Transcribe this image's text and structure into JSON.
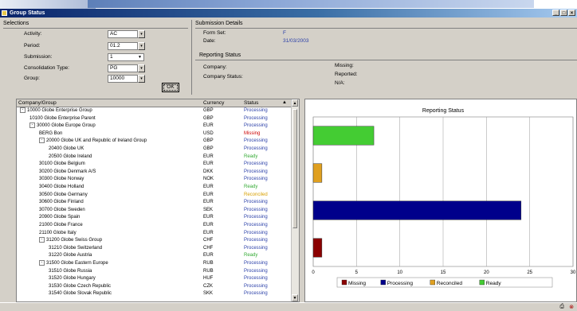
{
  "window": {
    "title": "Group Status",
    "buttons": [
      "_",
      "□",
      "×"
    ]
  },
  "selections": {
    "heading": "Selections",
    "fields": [
      {
        "label": "Activity:",
        "value": "AC"
      },
      {
        "label": "Period:",
        "value": "01.2"
      },
      {
        "label": "Submission:",
        "value": "1"
      },
      {
        "label": "Consolidation Type:",
        "value": "PG"
      },
      {
        "label": "Group:",
        "value": "10000"
      }
    ],
    "ok_label": "OK"
  },
  "submission_details": {
    "heading": "Submission Details",
    "rows": [
      {
        "label": "Form Set:",
        "value": "F"
      },
      {
        "label": "Date:",
        "value": "31/03/2003"
      }
    ]
  },
  "reporting_status_panel": {
    "heading": "Reporting Status",
    "left": [
      {
        "label": "Company:"
      },
      {
        "label": "Company Status:"
      }
    ],
    "right": [
      {
        "label": "Missing:"
      },
      {
        "label": "Reported:"
      },
      {
        "label": "N/A:"
      }
    ]
  },
  "tree": {
    "columns": [
      "Company/Group",
      "Currency",
      "Status"
    ],
    "rows": [
      {
        "name": "10000 Globe Enterprise Group",
        "indent": 0,
        "exp": "-",
        "currency": "GBP",
        "status": "Processing"
      },
      {
        "name": "10100 Globe Enterprise Parent",
        "indent": 1,
        "exp": "",
        "currency": "GBP",
        "status": "Processing"
      },
      {
        "name": "30000 Globe Europe Group",
        "indent": 1,
        "exp": "-",
        "currency": "EUR",
        "status": "Processing"
      },
      {
        "name": "BERG Bon",
        "indent": 2,
        "exp": "",
        "currency": "USD",
        "status": "Missing"
      },
      {
        "name": "20000 Globe UK and Republic of Ireland Group",
        "indent": 2,
        "exp": "-",
        "currency": "GBP",
        "status": "Processing"
      },
      {
        "name": "20400 Globe UK",
        "indent": 3,
        "exp": "",
        "currency": "GBP",
        "status": "Processing"
      },
      {
        "name": "20500 Globe Ireland",
        "indent": 3,
        "exp": "",
        "currency": "EUR",
        "status": "Ready"
      },
      {
        "name": "30100 Globe Belgium",
        "indent": 2,
        "exp": "",
        "currency": "EUR",
        "status": "Processing"
      },
      {
        "name": "30200 Globe Denmark A/S",
        "indent": 2,
        "exp": "",
        "currency": "DKK",
        "status": "Processing"
      },
      {
        "name": "30300 Globe Norway",
        "indent": 2,
        "exp": "",
        "currency": "NOK",
        "status": "Processing"
      },
      {
        "name": "30400 Globe Holland",
        "indent": 2,
        "exp": "",
        "currency": "EUR",
        "status": "Ready"
      },
      {
        "name": "30500 Globe Germany",
        "indent": 2,
        "exp": "",
        "currency": "EUR",
        "status": "Reconciled"
      },
      {
        "name": "30600 Globe Finland",
        "indent": 2,
        "exp": "",
        "currency": "EUR",
        "status": "Processing"
      },
      {
        "name": "30700 Globe Sweden",
        "indent": 2,
        "exp": "",
        "currency": "SEK",
        "status": "Processing"
      },
      {
        "name": "20900 Globe Spain",
        "indent": 2,
        "exp": "",
        "currency": "EUR",
        "status": "Processing"
      },
      {
        "name": "21000 Globe France",
        "indent": 2,
        "exp": "",
        "currency": "EUR",
        "status": "Processing"
      },
      {
        "name": "21100 Globe Italy",
        "indent": 2,
        "exp": "",
        "currency": "EUR",
        "status": "Processing"
      },
      {
        "name": "31200 Globe Swiss Group",
        "indent": 2,
        "exp": "-",
        "currency": "CHF",
        "status": "Processing"
      },
      {
        "name": "31210 Globe Switzerland",
        "indent": 3,
        "exp": "",
        "currency": "CHF",
        "status": "Processing"
      },
      {
        "name": "31220 Globe Austria",
        "indent": 3,
        "exp": "",
        "currency": "EUR",
        "status": "Ready"
      },
      {
        "name": "31500 Globe Eastern Europe",
        "indent": 2,
        "exp": "-",
        "currency": "RUB",
        "status": "Processing"
      },
      {
        "name": "31510 Globe Russia",
        "indent": 3,
        "exp": "",
        "currency": "RUB",
        "status": "Processing"
      },
      {
        "name": "31520 Globe Hungary",
        "indent": 3,
        "exp": "",
        "currency": "HUF",
        "status": "Processing"
      },
      {
        "name": "31530 Globe Czech Republic",
        "indent": 3,
        "exp": "",
        "currency": "CZK",
        "status": "Processing"
      },
      {
        "name": "31540 Globe Slovak Republic",
        "indent": 3,
        "exp": "",
        "currency": "SKK",
        "status": "Processing"
      }
    ]
  },
  "colors": {
    "missing": "#8b0000",
    "processing": "#00008b",
    "reconciled": "#e0a020",
    "ready": "#44cc33",
    "status_text_processing": "#2a3fa8",
    "status_text_missing": "#cc0000",
    "status_text_ready": "#33aa33",
    "status_text_reconciled": "#d8a000"
  },
  "chart_data": {
    "type": "bar",
    "orientation": "horizontal",
    "title": "Reporting Status",
    "categories": [
      "Missing",
      "Processing",
      "Reconciled",
      "Ready"
    ],
    "values": [
      1,
      24,
      1,
      7
    ],
    "xlim": [
      0,
      30
    ],
    "xticks": [
      "0",
      "5",
      "10",
      "15",
      "20",
      "25",
      "30"
    ],
    "grid": true,
    "legend": [
      "Missing",
      "Processing",
      "Reconciled",
      "Ready"
    ],
    "legend_position": "bottom"
  }
}
